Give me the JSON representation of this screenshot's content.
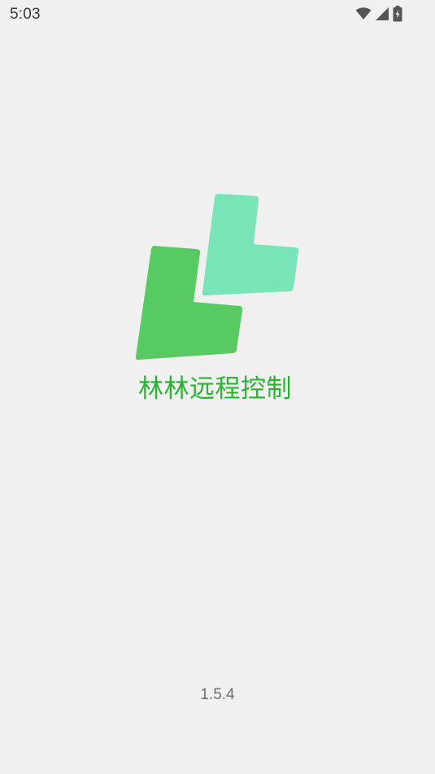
{
  "status_bar": {
    "time": "5:03",
    "icons": [
      "wifi-icon",
      "cellular-signal-icon",
      "battery-charging-icon"
    ]
  },
  "splash": {
    "app_name": "林林远程控制",
    "version": "1.5.4",
    "logo": "app-logo",
    "colors": {
      "background": "#f0f0f0",
      "title": "#27b42e",
      "logo_dark_green": "#58ca62",
      "logo_light_green": "#7ae4b9"
    }
  }
}
